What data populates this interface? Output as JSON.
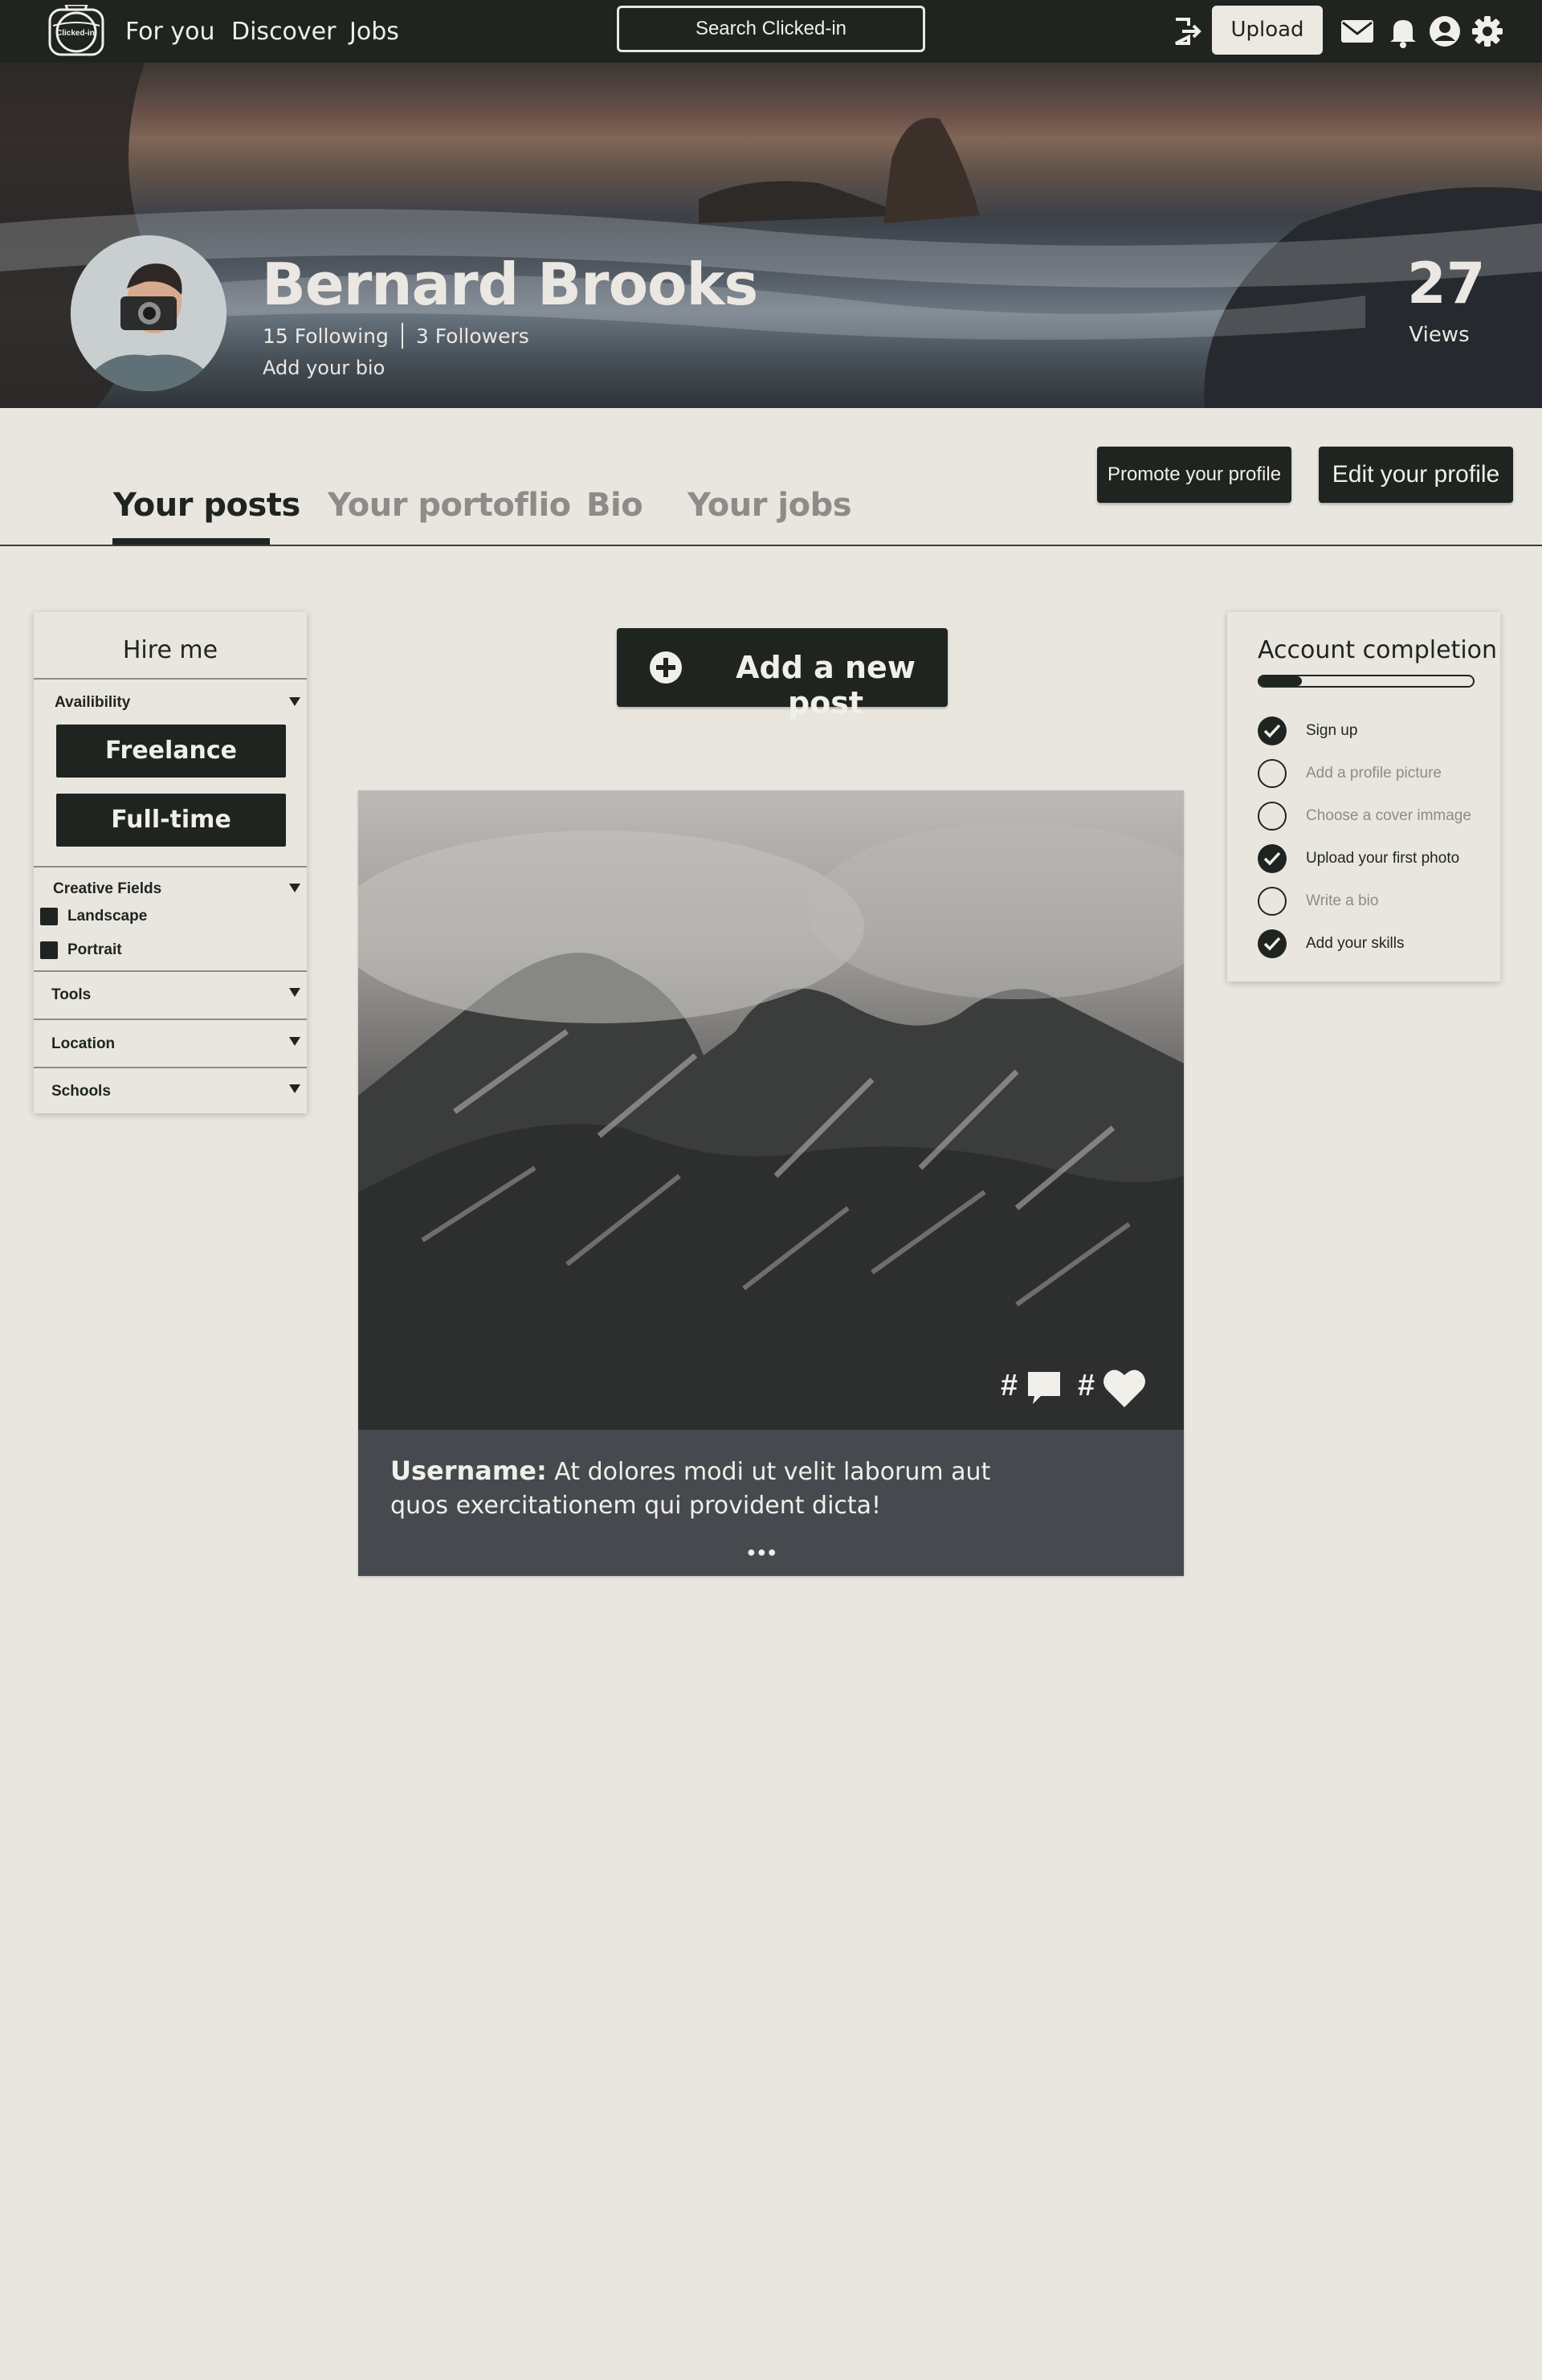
{
  "colors": {
    "dark": "#1f2420",
    "background": "#e9e6e0",
    "light_text": "#f1efe9",
    "muted_tab": "#8e8c88",
    "post_footer": "#464a4e"
  },
  "topbar": {
    "logo_text": "Clicked-in",
    "nav": [
      "For you",
      "Discover",
      "Jobs"
    ],
    "search_label": "Search Clicked-in",
    "upload_label": "Upload",
    "icons": [
      "logout-icon",
      "mail-icon",
      "bell-icon",
      "account-icon",
      "settings-icon"
    ]
  },
  "profile": {
    "name": "Bernard Brooks",
    "following": "15 Following",
    "followers": "3 Followers",
    "bio_prompt": "Add your bio",
    "views_count": "27",
    "views_label": "Views"
  },
  "actions": {
    "promote": "Promote your profile",
    "edit": "Edit your profile"
  },
  "tabs": [
    "Your posts",
    "Your portoflio",
    "Bio",
    "Your jobs"
  ],
  "active_tab": "Your posts",
  "hire_me": {
    "title": "Hire me",
    "availability": {
      "label": "Availibility",
      "options": [
        "Freelance",
        "Full-time"
      ]
    },
    "creative_fields": {
      "label": "Creative Fields",
      "options": [
        "Landscape",
        "Portrait"
      ]
    },
    "tools": "Tools",
    "location": "Location",
    "schools": "Schools"
  },
  "add_post_label": "Add a new post",
  "post": {
    "comments_count": "#",
    "likes_count": "#",
    "username": "Username:",
    "caption": "At dolores modi ut velit laborum aut quos exercitationem qui provident dicta!",
    "more_label": "●●●"
  },
  "account_completion": {
    "title": "Account completion",
    "progress": 0.2,
    "items": [
      {
        "label": "Sign up",
        "done": true
      },
      {
        "label": "Add a profile picture",
        "done": false
      },
      {
        "label": "Choose a cover immage",
        "done": false
      },
      {
        "label": "Upload your first photo",
        "done": true
      },
      {
        "label": "Write a bio",
        "done": false
      },
      {
        "label": "Add your skills",
        "done": true
      }
    ]
  }
}
